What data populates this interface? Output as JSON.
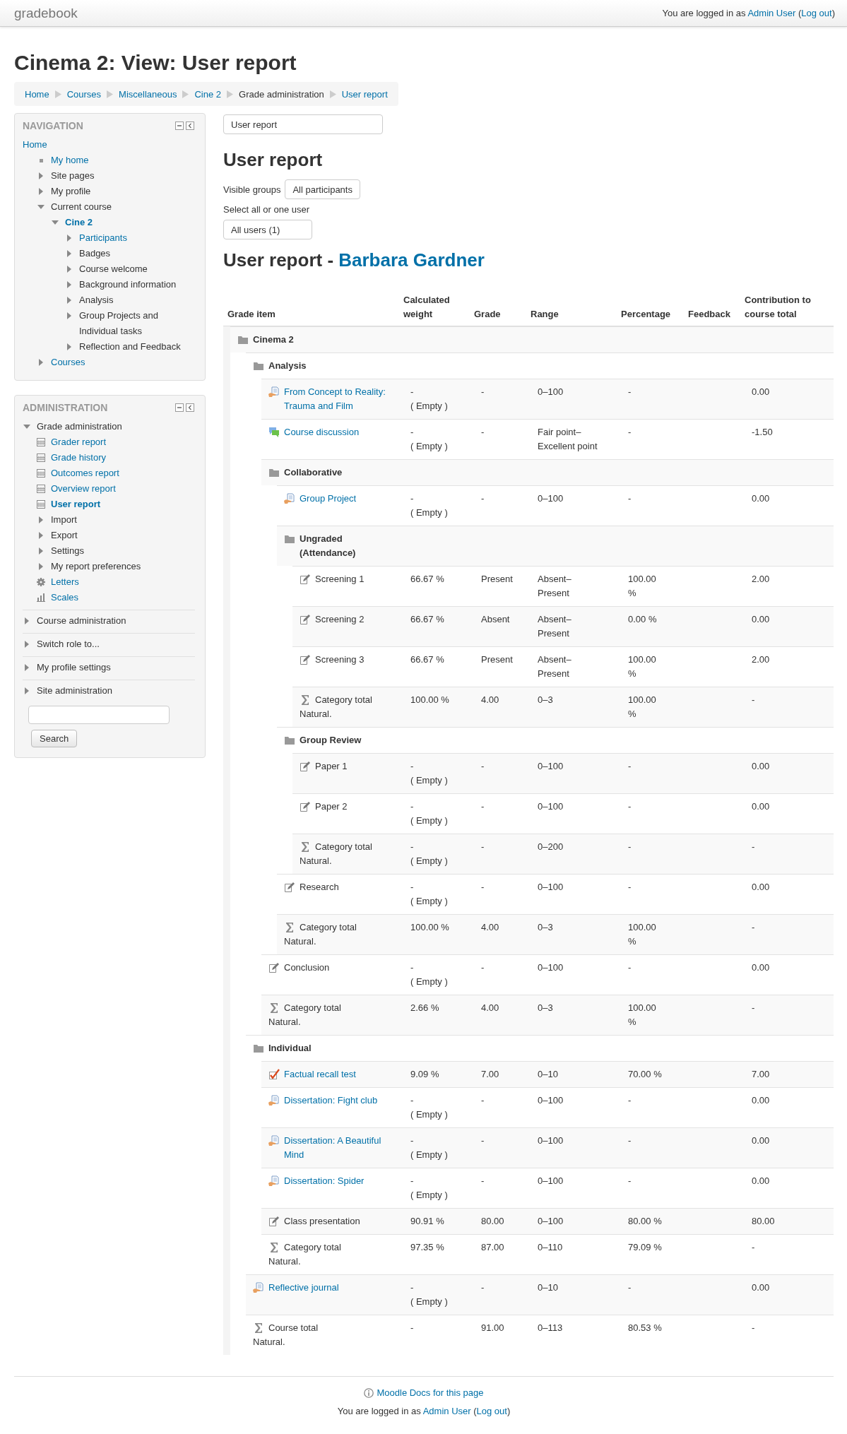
{
  "header": {
    "brand": "gradebook",
    "login": [
      {
        "text": "You are logged in as "
      },
      {
        "link": "Admin User"
      },
      {
        "text": " ("
      },
      {
        "link": "Log out"
      },
      {
        "text": ")"
      }
    ]
  },
  "page_title": "Cinema 2: View: User report",
  "breadcrumb": [
    {
      "label": "Home",
      "link": true
    },
    {
      "label": "Courses",
      "link": true
    },
    {
      "label": "Miscellaneous",
      "link": true
    },
    {
      "label": "Cine 2",
      "link": true
    },
    {
      "label": "Grade administration",
      "link": false
    },
    {
      "label": "User report",
      "link": true
    }
  ],
  "navigation": {
    "title": "NAVIGATION",
    "items": [
      {
        "label": "Home",
        "link": true,
        "active": false,
        "children": [
          {
            "label": "My home",
            "kind": "bullet",
            "link": true,
            "active": false
          },
          {
            "label": "Site pages",
            "kind": "branch",
            "expanded": false,
            "link": false,
            "active": false
          },
          {
            "label": "My profile",
            "kind": "branch",
            "expanded": false,
            "link": false,
            "active": false
          },
          {
            "label": "Current course",
            "kind": "branch",
            "expanded": true,
            "link": false,
            "active": false,
            "children": [
              {
                "label": "Cine 2",
                "kind": "branch",
                "expanded": true,
                "link": true,
                "active": true,
                "children": [
                  {
                    "label": "Participants",
                    "kind": "branch",
                    "expanded": false,
                    "link": true,
                    "active": false
                  },
                  {
                    "label": "Badges",
                    "kind": "branch",
                    "expanded": false,
                    "link": false,
                    "active": false
                  },
                  {
                    "label": "Course welcome",
                    "kind": "branch",
                    "expanded": false,
                    "link": false,
                    "active": false
                  },
                  {
                    "label": "Background information",
                    "kind": "branch",
                    "expanded": false,
                    "link": false,
                    "active": false
                  },
                  {
                    "label": "Analysis",
                    "kind": "branch",
                    "expanded": false,
                    "link": false,
                    "active": false
                  },
                  {
                    "label": "Group Projects and Individual tasks",
                    "kind": "branch",
                    "expanded": false,
                    "link": false,
                    "active": false
                  },
                  {
                    "label": "Reflection and Feedback",
                    "kind": "branch",
                    "expanded": false,
                    "link": false,
                    "active": false
                  }
                ]
              }
            ]
          },
          {
            "label": "Courses",
            "kind": "branch",
            "expanded": false,
            "link": true,
            "active": false
          }
        ]
      }
    ]
  },
  "administration": {
    "title": "ADMINISTRATION",
    "items": [
      {
        "label": "Grade administration",
        "kind": "branch",
        "expanded": true,
        "link": false,
        "active": false,
        "children": [
          {
            "label": "Grader report",
            "kind": "report",
            "link": true,
            "active": false
          },
          {
            "label": "Grade history",
            "kind": "report",
            "link": true,
            "active": false
          },
          {
            "label": "Outcomes report",
            "kind": "report",
            "link": true,
            "active": false
          },
          {
            "label": "Overview report",
            "kind": "report",
            "link": true,
            "active": false
          },
          {
            "label": "User report",
            "kind": "report",
            "link": true,
            "active": true
          },
          {
            "label": "Import",
            "kind": "branch",
            "expanded": false,
            "link": false,
            "active": false
          },
          {
            "label": "Export",
            "kind": "branch",
            "expanded": false,
            "link": false,
            "active": false
          },
          {
            "label": "Settings",
            "kind": "branch",
            "expanded": false,
            "link": false,
            "active": false
          },
          {
            "label": "My report preferences",
            "kind": "branch",
            "expanded": false,
            "link": false,
            "active": false
          },
          {
            "label": "Letters",
            "kind": "gear",
            "link": true,
            "active": false
          },
          {
            "label": "Scales",
            "kind": "scales",
            "link": true,
            "active": false
          }
        ]
      },
      {
        "label": "Course administration",
        "kind": "branch",
        "expanded": false,
        "link": false,
        "active": false
      },
      {
        "label": "Switch role to...",
        "kind": "branch",
        "expanded": false,
        "link": false,
        "active": false
      },
      {
        "label": "My profile settings",
        "kind": "branch",
        "expanded": false,
        "link": false,
        "active": false
      },
      {
        "label": "Site administration",
        "kind": "branch",
        "expanded": false,
        "link": false,
        "active": false
      }
    ],
    "search_button": "Search"
  },
  "report_select": {
    "value": "User report"
  },
  "heading": "User report",
  "groups": {
    "label": "Visible groups",
    "value": "All participants"
  },
  "user_select": {
    "label": "Select all or one user",
    "value": "All users (1)"
  },
  "report_heading": {
    "prefix": "User report - ",
    "student": "Barbara Gardner"
  },
  "table": {
    "columns": [
      "Grade item",
      "Calculated weight",
      "Grade",
      "Range",
      "Percentage",
      "Feedback",
      "Contribution to course total"
    ],
    "rows": [
      {
        "kind": "category",
        "name": "Cinema 2",
        "children": [
          {
            "kind": "category",
            "name": "Analysis",
            "children": [
              {
                "kind": "assignment",
                "name": "From Concept to Reality: Trauma and Film",
                "weight": "-",
                "weight_note": "( Empty )",
                "grade": "-",
                "range": "0–100",
                "percentage": "-",
                "contribution": "0.00"
              },
              {
                "kind": "forum",
                "name": "Course discussion",
                "weight": "-",
                "weight_note": "( Empty )",
                "grade": "-",
                "range": "Fair point–Excellent point",
                "percentage": "-",
                "contribution": "-1.50"
              },
              {
                "kind": "category",
                "name": "Collaborative",
                "children": [
                  {
                    "kind": "assignment",
                    "name": "Group Project",
                    "weight": "-",
                    "weight_note": "( Empty )",
                    "grade": "-",
                    "range": "0–100",
                    "percentage": "-",
                    "contribution": "0.00"
                  },
                  {
                    "kind": "category",
                    "name": "Ungraded (Attendance)",
                    "children": [
                      {
                        "kind": "manual",
                        "name": "Screening 1",
                        "weight": "66.67 %",
                        "grade": "Present",
                        "range": "Absent–Present",
                        "percentage": "100.00 %",
                        "contribution": "2.00"
                      },
                      {
                        "kind": "manual",
                        "name": "Screening 2",
                        "weight": "66.67 %",
                        "grade": "Absent",
                        "range": "Absent–Present",
                        "percentage": "0.00 %",
                        "contribution": "0.00"
                      },
                      {
                        "kind": "manual",
                        "name": "Screening 3",
                        "weight": "66.67 %",
                        "grade": "Present",
                        "range": "Absent–Present",
                        "percentage": "100.00 %",
                        "contribution": "2.00"
                      },
                      {
                        "kind": "total",
                        "name": "Category total",
                        "note": "Natural.",
                        "weight": "100.00 %",
                        "grade": "4.00",
                        "range": "0–3",
                        "percentage": "100.00 %",
                        "contribution": "-"
                      }
                    ]
                  },
                  {
                    "kind": "category",
                    "name": "Group Review",
                    "children": [
                      {
                        "kind": "manual",
                        "name": "Paper 1",
                        "weight": "-",
                        "weight_note": "( Empty )",
                        "grade": "-",
                        "range": "0–100",
                        "percentage": "-",
                        "contribution": "0.00"
                      },
                      {
                        "kind": "manual",
                        "name": "Paper 2",
                        "weight": "-",
                        "weight_note": "( Empty )",
                        "grade": "-",
                        "range": "0–100",
                        "percentage": "-",
                        "contribution": "0.00"
                      },
                      {
                        "kind": "total",
                        "name": "Category total",
                        "note": "Natural.",
                        "weight": "-",
                        "weight_note": "( Empty )",
                        "grade": "-",
                        "range": "0–200",
                        "percentage": "-",
                        "contribution": "-"
                      }
                    ]
                  },
                  {
                    "kind": "manual",
                    "name": "Research",
                    "weight": "-",
                    "weight_note": "( Empty )",
                    "grade": "-",
                    "range": "0–100",
                    "percentage": "-",
                    "contribution": "0.00"
                  },
                  {
                    "kind": "total",
                    "name": "Category total",
                    "note": "Natural.",
                    "weight": "100.00 %",
                    "grade": "4.00",
                    "range": "0–3",
                    "percentage": "100.00 %",
                    "contribution": "-"
                  }
                ]
              },
              {
                "kind": "manual",
                "name": "Conclusion",
                "weight": "-",
                "weight_note": "( Empty )",
                "grade": "-",
                "range": "0–100",
                "percentage": "-",
                "contribution": "0.00"
              },
              {
                "kind": "total",
                "name": "Category total",
                "note": "Natural.",
                "weight": "2.66 %",
                "grade": "4.00",
                "range": "0–3",
                "percentage": "100.00 %",
                "contribution": "-"
              }
            ]
          },
          {
            "kind": "category",
            "name": "Individual",
            "children": [
              {
                "kind": "quiz",
                "name": "Factual recall test",
                "weight": "9.09 %",
                "grade": "7.00",
                "range": "0–10",
                "percentage": "70.00 %",
                "contribution": "7.00"
              },
              {
                "kind": "assignment",
                "name": "Dissertation: Fight club",
                "weight": "-",
                "weight_note": "( Empty )",
                "grade": "-",
                "range": "0–100",
                "percentage": "-",
                "contribution": "0.00"
              },
              {
                "kind": "assignment",
                "name": "Dissertation: A Beautiful Mind",
                "weight": "-",
                "weight_note": "( Empty )",
                "grade": "-",
                "range": "0–100",
                "percentage": "-",
                "contribution": "0.00"
              },
              {
                "kind": "assignment",
                "name": "Dissertation: Spider",
                "weight": "-",
                "weight_note": "( Empty )",
                "grade": "-",
                "range": "0–100",
                "percentage": "-",
                "contribution": "0.00"
              },
              {
                "kind": "manual",
                "name": "Class presentation",
                "weight": "90.91 %",
                "grade": "80.00",
                "range": "0–100",
                "percentage": "80.00 %",
                "contribution": "80.00"
              },
              {
                "kind": "total",
                "name": "Category total",
                "note": "Natural.",
                "weight": "97.35 %",
                "grade": "87.00",
                "range": "0–110",
                "percentage": "79.09 %",
                "contribution": "-"
              }
            ]
          },
          {
            "kind": "assignment",
            "name": "Reflective journal",
            "weight": "-",
            "weight_note": "( Empty )",
            "grade": "-",
            "range": "0–10",
            "percentage": "-",
            "contribution": "0.00"
          },
          {
            "kind": "total",
            "name": "Course total",
            "note": "Natural.",
            "weight": "-",
            "grade": "91.00",
            "range": "0–113",
            "percentage": "80.53 %",
            "contribution": "-"
          }
        ]
      }
    ]
  },
  "footer": {
    "docs_link": "Moodle Docs for this page",
    "login": [
      {
        "text": "You are logged in as "
      },
      {
        "link": "Admin User"
      },
      {
        "text": " ("
      },
      {
        "link": "Log out"
      },
      {
        "text": ")"
      }
    ]
  }
}
